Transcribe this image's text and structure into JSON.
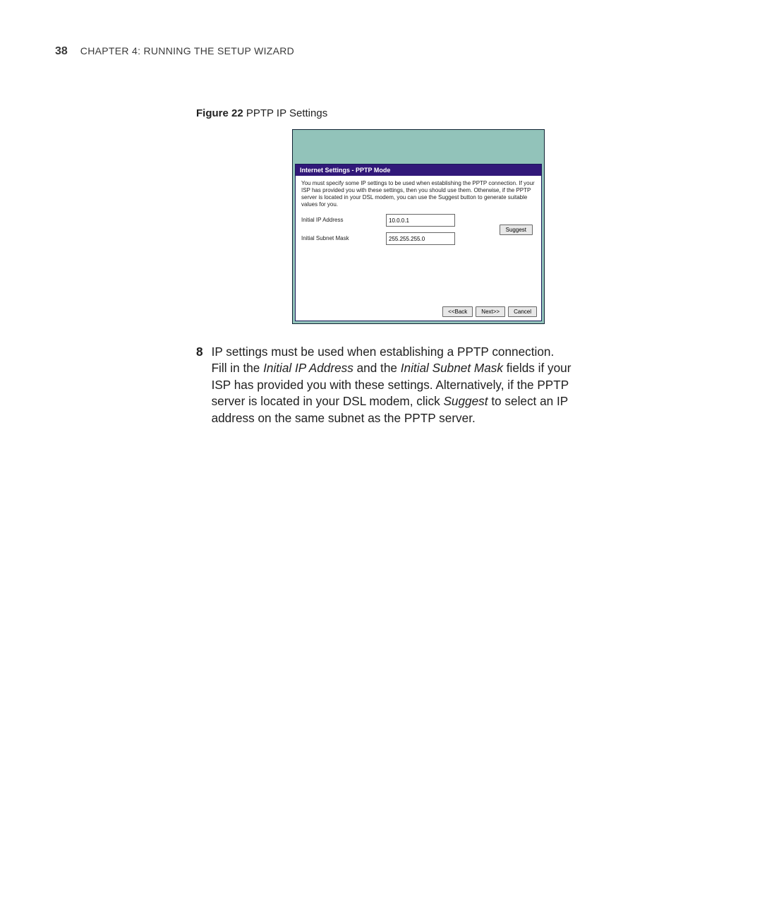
{
  "header": {
    "page_number": "38",
    "chapter_prefix": "C",
    "chapter_word": "HAPTER",
    "chapter_num": " 4: R",
    "chapter_rest": "UNNING THE ",
    "chapter_s": "S",
    "chapter_setup": "ETUP ",
    "chapter_w": "W",
    "chapter_wiz": "IZARD"
  },
  "figure": {
    "label_bold": "Figure 22",
    "label_rest": "   PPTP IP Settings"
  },
  "screenshot": {
    "panel_title": "Internet Settings - PPTP Mode",
    "description": "You must specify some IP settings to be used when establishing the PPTP connection. If your ISP has provided you with these settings, then you should use them. Otherwise, if the PPTP server is located in your DSL modem, you can use the Suggest button to generate suitable values for you.",
    "ip_label": "Initial IP Address",
    "ip_value": "10.0.0.1",
    "mask_label": "Initial Subnet Mask",
    "mask_value": "255.255.255.0",
    "suggest": "Suggest",
    "back": "<<Back",
    "next": "Next>>",
    "cancel": "Cancel"
  },
  "step": {
    "num": "8",
    "t1": "IP settings must be used when establishing a PPTP connection. Fill in the ",
    "i1": "Initial IP Address",
    "t2": " and the ",
    "i2": "Initial Subnet Mask",
    "t3": " fields if your ISP has provided you with these settings. Alternatively, if the PPTP server is located in your DSL modem, click ",
    "i3": "Suggest",
    "t4": " to select an IP address on the same subnet as the PPTP server."
  }
}
